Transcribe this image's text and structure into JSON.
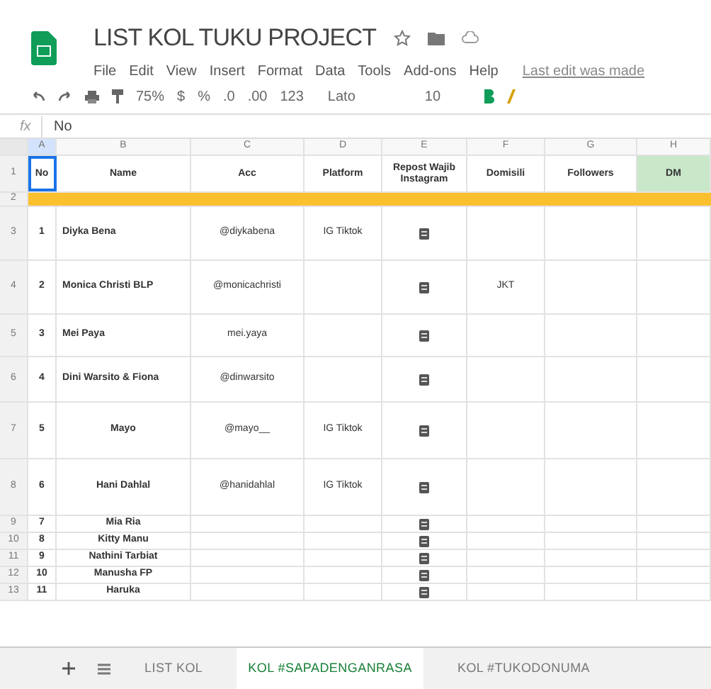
{
  "document": {
    "title": "LIST KOL TUKU PROJECT",
    "last_edit": "Last edit was made"
  },
  "menu": [
    "File",
    "Edit",
    "View",
    "Insert",
    "Format",
    "Data",
    "Tools",
    "Add-ons",
    "Help"
  ],
  "toolbar": {
    "zoom": "75%",
    "currency": "$",
    "percent": "%",
    "decimal_less": ".0",
    "decimal_more": ".00",
    "number_format": "123",
    "font": "Lato",
    "font_size": "10"
  },
  "formula_bar": {
    "fx": "fx",
    "value": "No"
  },
  "columns": [
    {
      "letter": "A",
      "header": "No",
      "selected": true
    },
    {
      "letter": "B",
      "header": "Name",
      "selected": false
    },
    {
      "letter": "C",
      "header": "Acc",
      "selected": false
    },
    {
      "letter": "D",
      "header": "Platform",
      "selected": false
    },
    {
      "letter": "E",
      "header": "Repost Wajib Instagram",
      "selected": false
    },
    {
      "letter": "F",
      "header": "Domisili",
      "selected": false
    },
    {
      "letter": "G",
      "header": "Followers",
      "selected": false
    },
    {
      "letter": "H",
      "header": "DM",
      "selected": false
    }
  ],
  "header_row": "1",
  "band_row": "2",
  "rows": [
    {
      "row": "3",
      "no": "1",
      "name": "Diyka Bena",
      "acc": "@diykabena",
      "platform": "IG Tiktok",
      "domicile": ""
    },
    {
      "row": "4",
      "no": "2",
      "name": "Monica Christi BLP",
      "acc": "@monicachristi",
      "platform": "",
      "domicile": "JKT"
    },
    {
      "row": "5",
      "no": "3",
      "name": "Mei Paya",
      "acc": "mei.yaya",
      "platform": "",
      "domicile": ""
    },
    {
      "row": "6",
      "no": "4",
      "name": "Dini Warsito & Fiona",
      "acc": "@dinwarsito",
      "platform": "",
      "domicile": ""
    },
    {
      "row": "7",
      "no": "5",
      "name": "Mayo",
      "acc": "@mayo__",
      "platform": "IG Tiktok",
      "domicile": ""
    },
    {
      "row": "8",
      "no": "6",
      "name": "Hani Dahlal",
      "acc": "@hanidahlal",
      "platform": "IG Tiktok",
      "domicile": ""
    },
    {
      "row": "9",
      "no": "7",
      "name": "Mia Ria",
      "acc": "",
      "platform": "",
      "domicile": ""
    },
    {
      "row": "10",
      "no": "8",
      "name": "Kitty Manu",
      "acc": "",
      "platform": "",
      "domicile": ""
    },
    {
      "row": "11",
      "no": "9",
      "name": "Nathini Tarbiat",
      "acc": "",
      "platform": "",
      "domicile": ""
    },
    {
      "row": "12",
      "no": "10",
      "name": "Manusha FP",
      "acc": "",
      "platform": "",
      "domicile": ""
    },
    {
      "row": "13",
      "no": "11",
      "name": "Haruka",
      "acc": "",
      "platform": "",
      "domicile": ""
    }
  ],
  "sheet_tabs": [
    {
      "label": "LIST KOL",
      "selected": false
    },
    {
      "label": "KOL #SAPADENGANRASA",
      "selected": true
    },
    {
      "label": "KOL #TUKODONUMA",
      "selected": false
    }
  ]
}
